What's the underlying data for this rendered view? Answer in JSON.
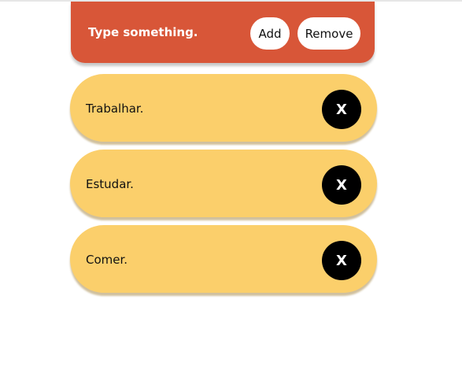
{
  "header": {
    "input_placeholder": "Type something.",
    "add_label": "Add",
    "remove_label": "Remove"
  },
  "tasks": [
    {
      "label": "Trabalhar.",
      "delete_label": "X"
    },
    {
      "label": "Estudar.",
      "delete_label": "X"
    },
    {
      "label": "Comer.",
      "delete_label": "X"
    }
  ],
  "colors": {
    "header_bg": "#d85638",
    "card_bg": "#fbcf6b",
    "button_bg": "#ffffff",
    "delete_bg": "#000000"
  }
}
